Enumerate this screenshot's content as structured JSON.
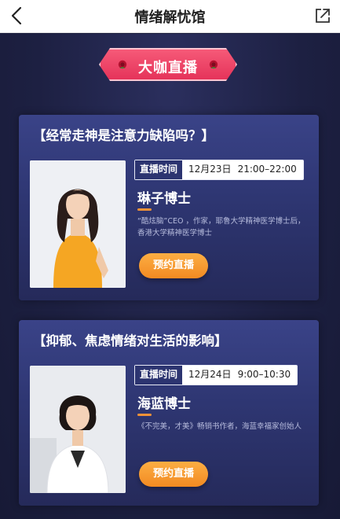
{
  "nav": {
    "title": "情绪解忧馆",
    "back_icon": "chevron-left-icon",
    "share_icon": "share-external-icon"
  },
  "banner": {
    "label": "大咖直播",
    "icon": "rose-icon"
  },
  "colors": {
    "background": "#1c1f3e",
    "banner": "#e5345a",
    "button": "#f28a22",
    "accent_line": "#f39237"
  },
  "lives": [
    {
      "topic": "【经常走神是注意力缺陷吗？】",
      "time_label": "直播时间",
      "date": "12月23日",
      "time": "21:00–22:00",
      "doctor": "琳子博士",
      "desc": "“酷炫脑”CEO ，作家，耶鲁大学精神医学博士后，香港大学精神医学博士",
      "button": "预约直播"
    },
    {
      "topic": "【抑郁、焦虑情绪对生活的影响】",
      "time_label": "直播时间",
      "date": "12月24日",
      "time": "9:00–10:30",
      "doctor": "海蓝博士",
      "desc": "《不完美，才美》畅销书作者，海蓝幸福家创始人",
      "button": "预约直播"
    }
  ]
}
